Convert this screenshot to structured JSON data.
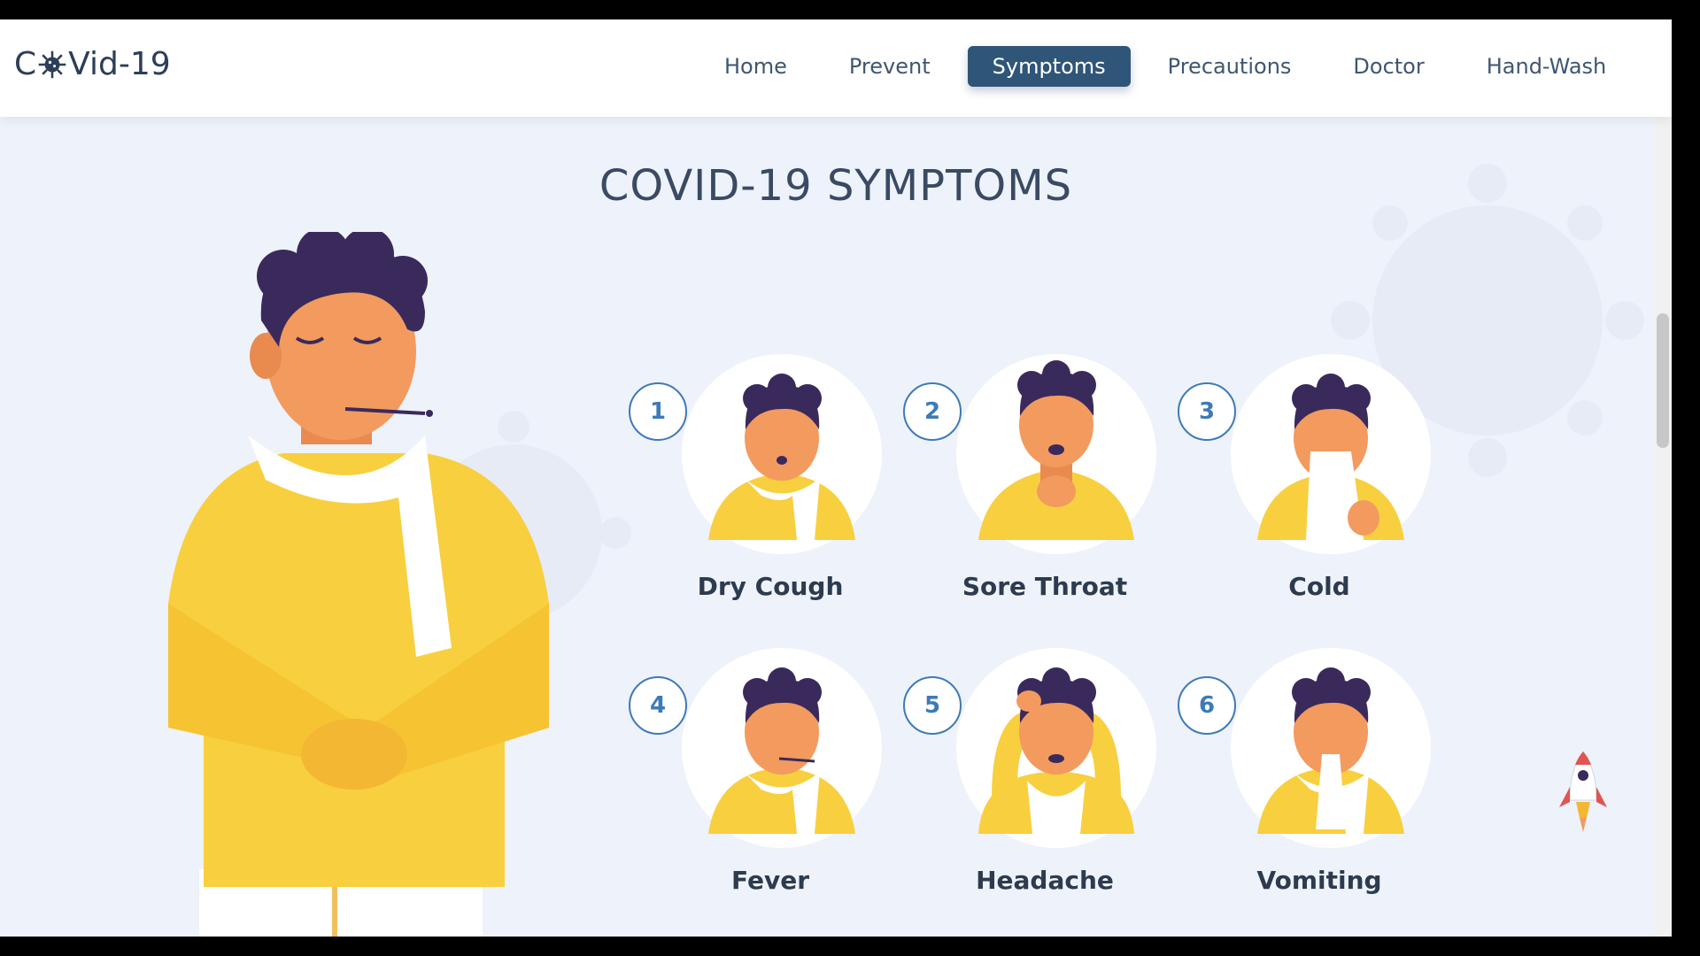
{
  "brand": {
    "prefix": "C",
    "suffix": "Vid-19"
  },
  "nav": [
    {
      "label": "Home"
    },
    {
      "label": "Prevent"
    },
    {
      "label": "Symptoms",
      "active": true
    },
    {
      "label": "Precautions"
    },
    {
      "label": "Doctor"
    },
    {
      "label": "Hand-Wash"
    }
  ],
  "title": "COVID-19 SYMPTOMS",
  "symptoms": [
    {
      "number": "1",
      "label": "Dry Cough"
    },
    {
      "number": "2",
      "label": "Sore Throat"
    },
    {
      "number": "3",
      "label": "Cold"
    },
    {
      "number": "4",
      "label": "Fever"
    },
    {
      "number": "5",
      "label": "Headache"
    },
    {
      "number": "6",
      "label": "Vomiting"
    }
  ],
  "colors": {
    "accent": "#2f5578",
    "number_ring": "#3e7ab8",
    "sweater": "#f8cf3e",
    "skin": "#f39a5f",
    "hair": "#3a2a5c",
    "background": "#eef2fb"
  }
}
